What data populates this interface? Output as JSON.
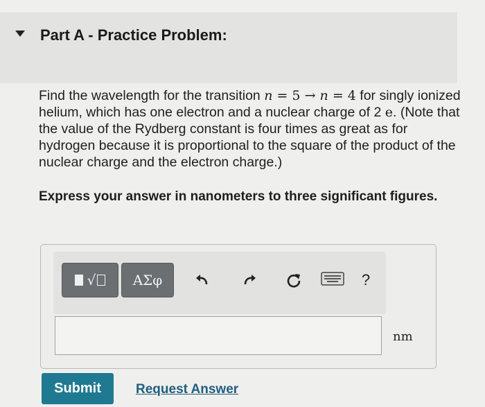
{
  "part": {
    "title": "Part A - Practice Problem:"
  },
  "problem": {
    "text_1": "Find the wavelength for the transition ",
    "math_n1": "n",
    "math_eq1": " = 5 → ",
    "math_n2": "n",
    "math_eq2": " = 4",
    "text_2": " for singly ionized helium, which has one electron and a nuclear charge of 2 ",
    "math_e": "e",
    "text_3": ". (Note that the value of the Rydberg constant is four times as great as for hydrogen because it is proportional to the square of the product of the nuclear charge and the electron charge.)"
  },
  "instruction": "Express your answer in nanometers to three significant figures.",
  "toolbar": {
    "templates_icon": "templates-icon",
    "symbols_label": "ΑΣφ",
    "undo_icon": "undo-icon",
    "redo_icon": "redo-icon",
    "reset_icon": "reset-icon",
    "keyboard_icon": "keyboard-icon",
    "help_label": "?"
  },
  "answer": {
    "value": "",
    "unit": "nm"
  },
  "actions": {
    "submit_label": "Submit",
    "request_label": "Request Answer"
  },
  "colors": {
    "submit_bg": "#1f7a91",
    "link": "#1f5f80",
    "toolbar_button": "#6b6f72"
  }
}
